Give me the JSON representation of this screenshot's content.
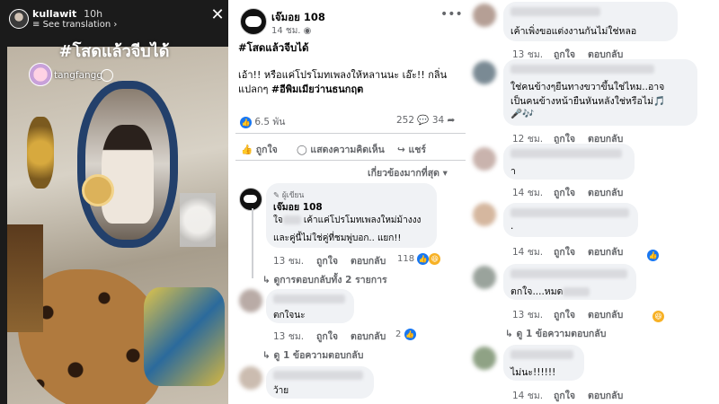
{
  "story": {
    "username": "kullawit",
    "time": "10h",
    "see_translation": "See translation",
    "hashtag": "#โสดแล้วจีบได้",
    "tag": "tangfangg"
  },
  "post": {
    "author": "เจ๊มอย 108",
    "time": "14 ชม.",
    "hashtag": "#โสดแล้วจีบได้",
    "body_line1": "เอ้า!! หรือแค่โปรโมทเพลงให้หลานนะ เอ๊ะ!! กลิ่น",
    "body_line2_prefix": "แปลกๆ ",
    "body_line2_tag": "#อีพิมเมียว่านธนกฤต",
    "reactions_count": "6.5 พัน",
    "comments_count": "252",
    "shares_count": "34",
    "like_label": "ถูกใจ",
    "comment_label": "แสดงความคิดเห็น",
    "share_label": "แชร์",
    "sort_label": "เกี่ยวข้องมากที่สุด"
  },
  "author_reply": {
    "badge": "ผู้เขียน",
    "name": "เจ๊มอย 108",
    "line1_a": "ใจ",
    "line1_b": " เค้าแค่โปรโมทเพลงใหม่ม้างงง",
    "line2": "และคู่นี้ไม่ใช่คู่ที่ชมพู่บอก.. แยก!!",
    "time": "13 ชม.",
    "like": "ถูกใจ",
    "reply": "ตอบกลับ",
    "reaction_count": "118",
    "view_replies": "ดูการตอบกลับทั้ง 2 รายการ"
  },
  "mid_comments": [
    {
      "text": "ตกใจนะ",
      "time": "13 ชม.",
      "like": "ถูกใจ",
      "reply": "ตอบกลับ",
      "reaction_count": "2",
      "view_replies": "ดู 1 ข้อความตอบกลับ"
    },
    {
      "text": "ว้าย"
    }
  ],
  "right_comments": [
    {
      "text": "เค้าเพิ่งขอแต่งงานกันไม่ใช่หลอ",
      "time": "13 ชม.",
      "like": "ถูกใจ",
      "reply": "ตอบกลับ"
    },
    {
      "line1": "ใช่คนข้างๆยืนทางขวาขึ้นใช่ไหม..อาจ",
      "line2": "เป็นคนข้างหน้ายืนหันหลังใช่หรือไม่🎵",
      "line3": "🎤🎶",
      "time": "12 ชม.",
      "like": "ถูกใจ",
      "reply": "ตอบกลับ"
    },
    {
      "text": "า",
      "time": "14 ชม.",
      "like": "ถูกใจ",
      "reply": "ตอบกลับ"
    },
    {
      "text": ".",
      "time": "14 ชม.",
      "like": "ถูกใจ",
      "reply": "ตอบกลับ"
    },
    {
      "text_a": "ตกใจ....หมด",
      "time": "13 ชม.",
      "like": "ถูกใจ",
      "reply": "ตอบกลับ",
      "view_replies": "ดู 1 ข้อความตอบกลับ"
    },
    {
      "text": "ไม่นะ!!!!!!",
      "time": "14 ชม.",
      "like": "ถูกใจ",
      "reply": "ตอบกลับ"
    }
  ]
}
